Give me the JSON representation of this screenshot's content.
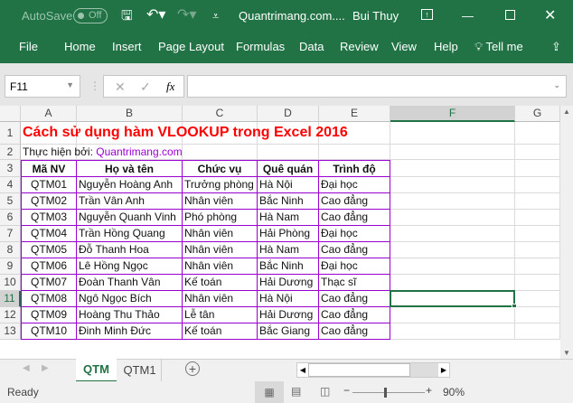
{
  "titlebar": {
    "autosave": "AutoSave",
    "autosave_state": "Off",
    "title": "Quantrimang.com....",
    "user": "Bui Thuy"
  },
  "ribbon": {
    "tabs": [
      "File",
      "Home",
      "Insert",
      "Page Layout",
      "Formulas",
      "Data",
      "Review",
      "View",
      "Help"
    ],
    "tell_me": "Tell me"
  },
  "formula_bar": {
    "name_box": "F11",
    "fx": "fx",
    "value": ""
  },
  "columns": [
    "A",
    "B",
    "C",
    "D",
    "E",
    "F",
    "G"
  ],
  "rows": [
    "1",
    "2",
    "3",
    "4",
    "5",
    "6",
    "7",
    "8",
    "9",
    "10",
    "11",
    "12",
    "13"
  ],
  "sheet": {
    "title": "Cách sử dụng hàm VLOOKUP trong Excel 2016",
    "subtitle_label": "Thực hiện bởi:",
    "subtitle_link": "Quantrimang.com",
    "headers": [
      "Mã NV",
      "Họ và tên",
      "Chức vụ",
      "Quê quán",
      "Trình độ"
    ],
    "data": [
      [
        "QTM01",
        "Nguyễn Hoàng Anh",
        "Trưởng phòng",
        "Hà Nội",
        "Đại học"
      ],
      [
        "QTM02",
        "Trần Vân Anh",
        "Nhân viên",
        "Bắc Ninh",
        "Cao đẳng"
      ],
      [
        "QTM03",
        "Nguyễn Quanh Vinh",
        "Phó phòng",
        "Hà Nam",
        "Cao đẳng"
      ],
      [
        "QTM04",
        "Trần Hồng Quang",
        "Nhân viên",
        "Hải Phòng",
        "Đại học"
      ],
      [
        "QTM05",
        "Đỗ Thanh Hoa",
        "Nhân viên",
        "Hà Nam",
        "Cao đẳng"
      ],
      [
        "QTM06",
        "Lê Hồng Ngọc",
        "Nhân viên",
        "Bắc Ninh",
        "Đại học"
      ],
      [
        "QTM07",
        "Đoàn Thanh Vân",
        "Kế toán",
        "Hải Dương",
        "Thạc sĩ"
      ],
      [
        "QTM08",
        "Ngô Ngọc Bích",
        "Nhân viên",
        "Hà Nội",
        "Cao đẳng"
      ],
      [
        "QTM09",
        "Hoàng Thu Thảo",
        "Lễ tân",
        "Hải Dương",
        "Cao đẳng"
      ],
      [
        "QTM10",
        "Đinh Minh Đức",
        "Kế toán",
        "Bắc Giang",
        "Cao đẳng"
      ]
    ]
  },
  "sheet_tabs": [
    "QTM",
    "QTM1"
  ],
  "status": {
    "ready": "Ready",
    "zoom": "90%"
  },
  "colors": {
    "accent": "#217346",
    "title_red": "#ff0000",
    "link": "#9b00d3",
    "border": "#9b00d3"
  }
}
